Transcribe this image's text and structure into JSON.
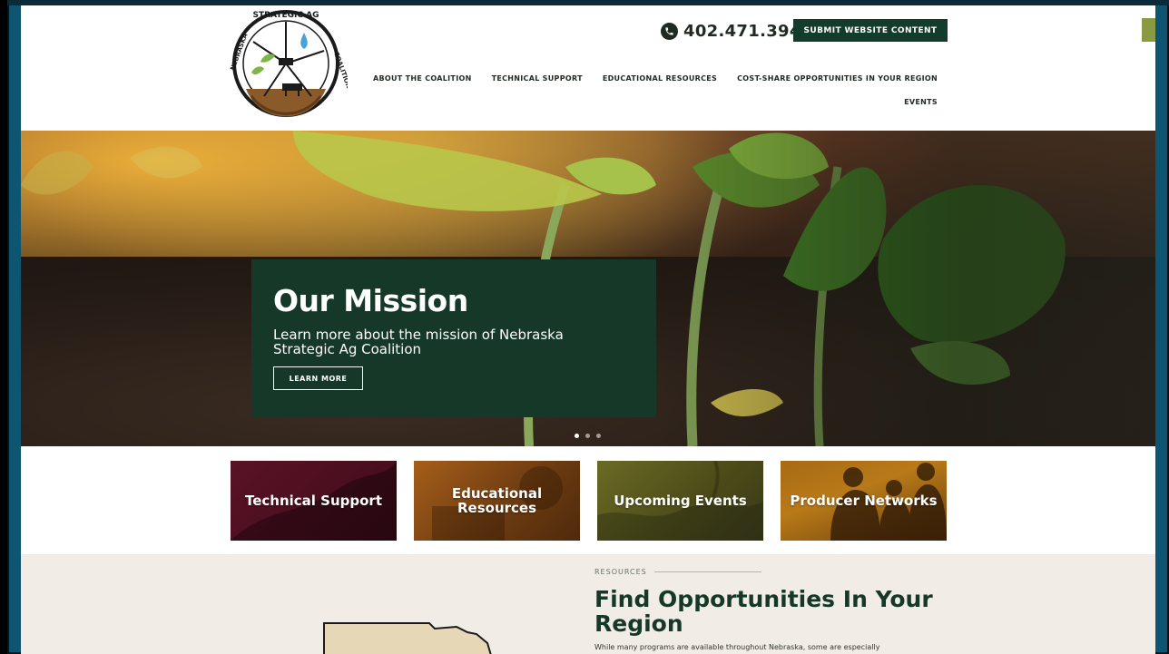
{
  "header": {
    "logo_text": "NEBRASKA STRATEGIC AG COALITION",
    "phone": "402.471.3948",
    "submit_button": "SUBMIT WEBSITE CONTENT",
    "nav": [
      "ABOUT THE COALITION",
      "TECHNICAL SUPPORT",
      "EDUCATIONAL RESOURCES",
      "COST-SHARE OPPORTUNITIES IN YOUR REGION"
    ],
    "nav_second_row": "EVENTS"
  },
  "hero": {
    "title": "Our Mission",
    "text": "Learn more about the mission of Nebraska Strategic Ag Coalition",
    "button": "LEARN MORE",
    "slides": 3,
    "active_slide": 1
  },
  "tiles": [
    {
      "label": "Technical Support"
    },
    {
      "label": "Educational Resources"
    },
    {
      "label": "Upcoming Events"
    },
    {
      "label": "Producer Networks"
    }
  ],
  "resources": {
    "eyebrow": "RESOURCES",
    "title": "Find Opportunities In Your Region",
    "text": "While many programs are available throughout Nebraska, some are especially"
  },
  "colors": {
    "brand_green": "#133c2c",
    "tile_maroon": "#5a1226",
    "page_bg": "#0b4a66"
  }
}
